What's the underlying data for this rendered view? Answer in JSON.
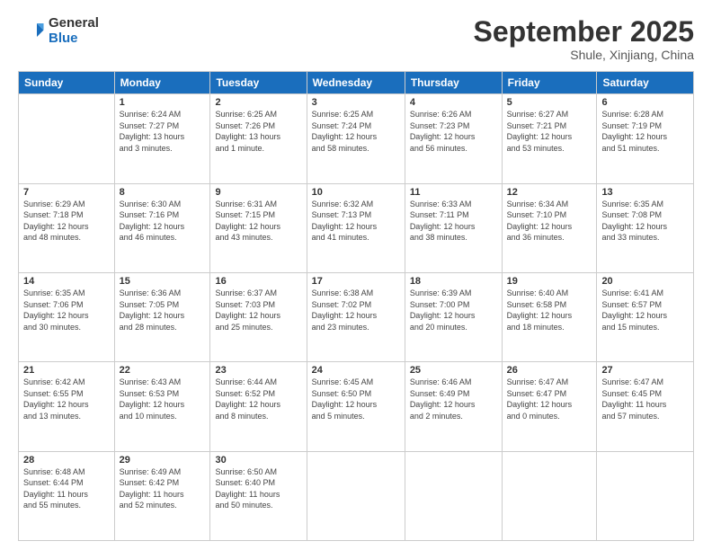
{
  "logo": {
    "general": "General",
    "blue": "Blue"
  },
  "title": "September 2025",
  "subtitle": "Shule, Xinjiang, China",
  "days_header": [
    "Sunday",
    "Monday",
    "Tuesday",
    "Wednesday",
    "Thursday",
    "Friday",
    "Saturday"
  ],
  "weeks": [
    [
      {
        "day": "",
        "info": ""
      },
      {
        "day": "1",
        "info": "Sunrise: 6:24 AM\nSunset: 7:27 PM\nDaylight: 13 hours\nand 3 minutes."
      },
      {
        "day": "2",
        "info": "Sunrise: 6:25 AM\nSunset: 7:26 PM\nDaylight: 13 hours\nand 1 minute."
      },
      {
        "day": "3",
        "info": "Sunrise: 6:25 AM\nSunset: 7:24 PM\nDaylight: 12 hours\nand 58 minutes."
      },
      {
        "day": "4",
        "info": "Sunrise: 6:26 AM\nSunset: 7:23 PM\nDaylight: 12 hours\nand 56 minutes."
      },
      {
        "day": "5",
        "info": "Sunrise: 6:27 AM\nSunset: 7:21 PM\nDaylight: 12 hours\nand 53 minutes."
      },
      {
        "day": "6",
        "info": "Sunrise: 6:28 AM\nSunset: 7:19 PM\nDaylight: 12 hours\nand 51 minutes."
      }
    ],
    [
      {
        "day": "7",
        "info": "Sunrise: 6:29 AM\nSunset: 7:18 PM\nDaylight: 12 hours\nand 48 minutes."
      },
      {
        "day": "8",
        "info": "Sunrise: 6:30 AM\nSunset: 7:16 PM\nDaylight: 12 hours\nand 46 minutes."
      },
      {
        "day": "9",
        "info": "Sunrise: 6:31 AM\nSunset: 7:15 PM\nDaylight: 12 hours\nand 43 minutes."
      },
      {
        "day": "10",
        "info": "Sunrise: 6:32 AM\nSunset: 7:13 PM\nDaylight: 12 hours\nand 41 minutes."
      },
      {
        "day": "11",
        "info": "Sunrise: 6:33 AM\nSunset: 7:11 PM\nDaylight: 12 hours\nand 38 minutes."
      },
      {
        "day": "12",
        "info": "Sunrise: 6:34 AM\nSunset: 7:10 PM\nDaylight: 12 hours\nand 36 minutes."
      },
      {
        "day": "13",
        "info": "Sunrise: 6:35 AM\nSunset: 7:08 PM\nDaylight: 12 hours\nand 33 minutes."
      }
    ],
    [
      {
        "day": "14",
        "info": "Sunrise: 6:35 AM\nSunset: 7:06 PM\nDaylight: 12 hours\nand 30 minutes."
      },
      {
        "day": "15",
        "info": "Sunrise: 6:36 AM\nSunset: 7:05 PM\nDaylight: 12 hours\nand 28 minutes."
      },
      {
        "day": "16",
        "info": "Sunrise: 6:37 AM\nSunset: 7:03 PM\nDaylight: 12 hours\nand 25 minutes."
      },
      {
        "day": "17",
        "info": "Sunrise: 6:38 AM\nSunset: 7:02 PM\nDaylight: 12 hours\nand 23 minutes."
      },
      {
        "day": "18",
        "info": "Sunrise: 6:39 AM\nSunset: 7:00 PM\nDaylight: 12 hours\nand 20 minutes."
      },
      {
        "day": "19",
        "info": "Sunrise: 6:40 AM\nSunset: 6:58 PM\nDaylight: 12 hours\nand 18 minutes."
      },
      {
        "day": "20",
        "info": "Sunrise: 6:41 AM\nSunset: 6:57 PM\nDaylight: 12 hours\nand 15 minutes."
      }
    ],
    [
      {
        "day": "21",
        "info": "Sunrise: 6:42 AM\nSunset: 6:55 PM\nDaylight: 12 hours\nand 13 minutes."
      },
      {
        "day": "22",
        "info": "Sunrise: 6:43 AM\nSunset: 6:53 PM\nDaylight: 12 hours\nand 10 minutes."
      },
      {
        "day": "23",
        "info": "Sunrise: 6:44 AM\nSunset: 6:52 PM\nDaylight: 12 hours\nand 8 minutes."
      },
      {
        "day": "24",
        "info": "Sunrise: 6:45 AM\nSunset: 6:50 PM\nDaylight: 12 hours\nand 5 minutes."
      },
      {
        "day": "25",
        "info": "Sunrise: 6:46 AM\nSunset: 6:49 PM\nDaylight: 12 hours\nand 2 minutes."
      },
      {
        "day": "26",
        "info": "Sunrise: 6:47 AM\nSunset: 6:47 PM\nDaylight: 12 hours\nand 0 minutes."
      },
      {
        "day": "27",
        "info": "Sunrise: 6:47 AM\nSunset: 6:45 PM\nDaylight: 11 hours\nand 57 minutes."
      }
    ],
    [
      {
        "day": "28",
        "info": "Sunrise: 6:48 AM\nSunset: 6:44 PM\nDaylight: 11 hours\nand 55 minutes."
      },
      {
        "day": "29",
        "info": "Sunrise: 6:49 AM\nSunset: 6:42 PM\nDaylight: 11 hours\nand 52 minutes."
      },
      {
        "day": "30",
        "info": "Sunrise: 6:50 AM\nSunset: 6:40 PM\nDaylight: 11 hours\nand 50 minutes."
      },
      {
        "day": "",
        "info": ""
      },
      {
        "day": "",
        "info": ""
      },
      {
        "day": "",
        "info": ""
      },
      {
        "day": "",
        "info": ""
      }
    ]
  ]
}
